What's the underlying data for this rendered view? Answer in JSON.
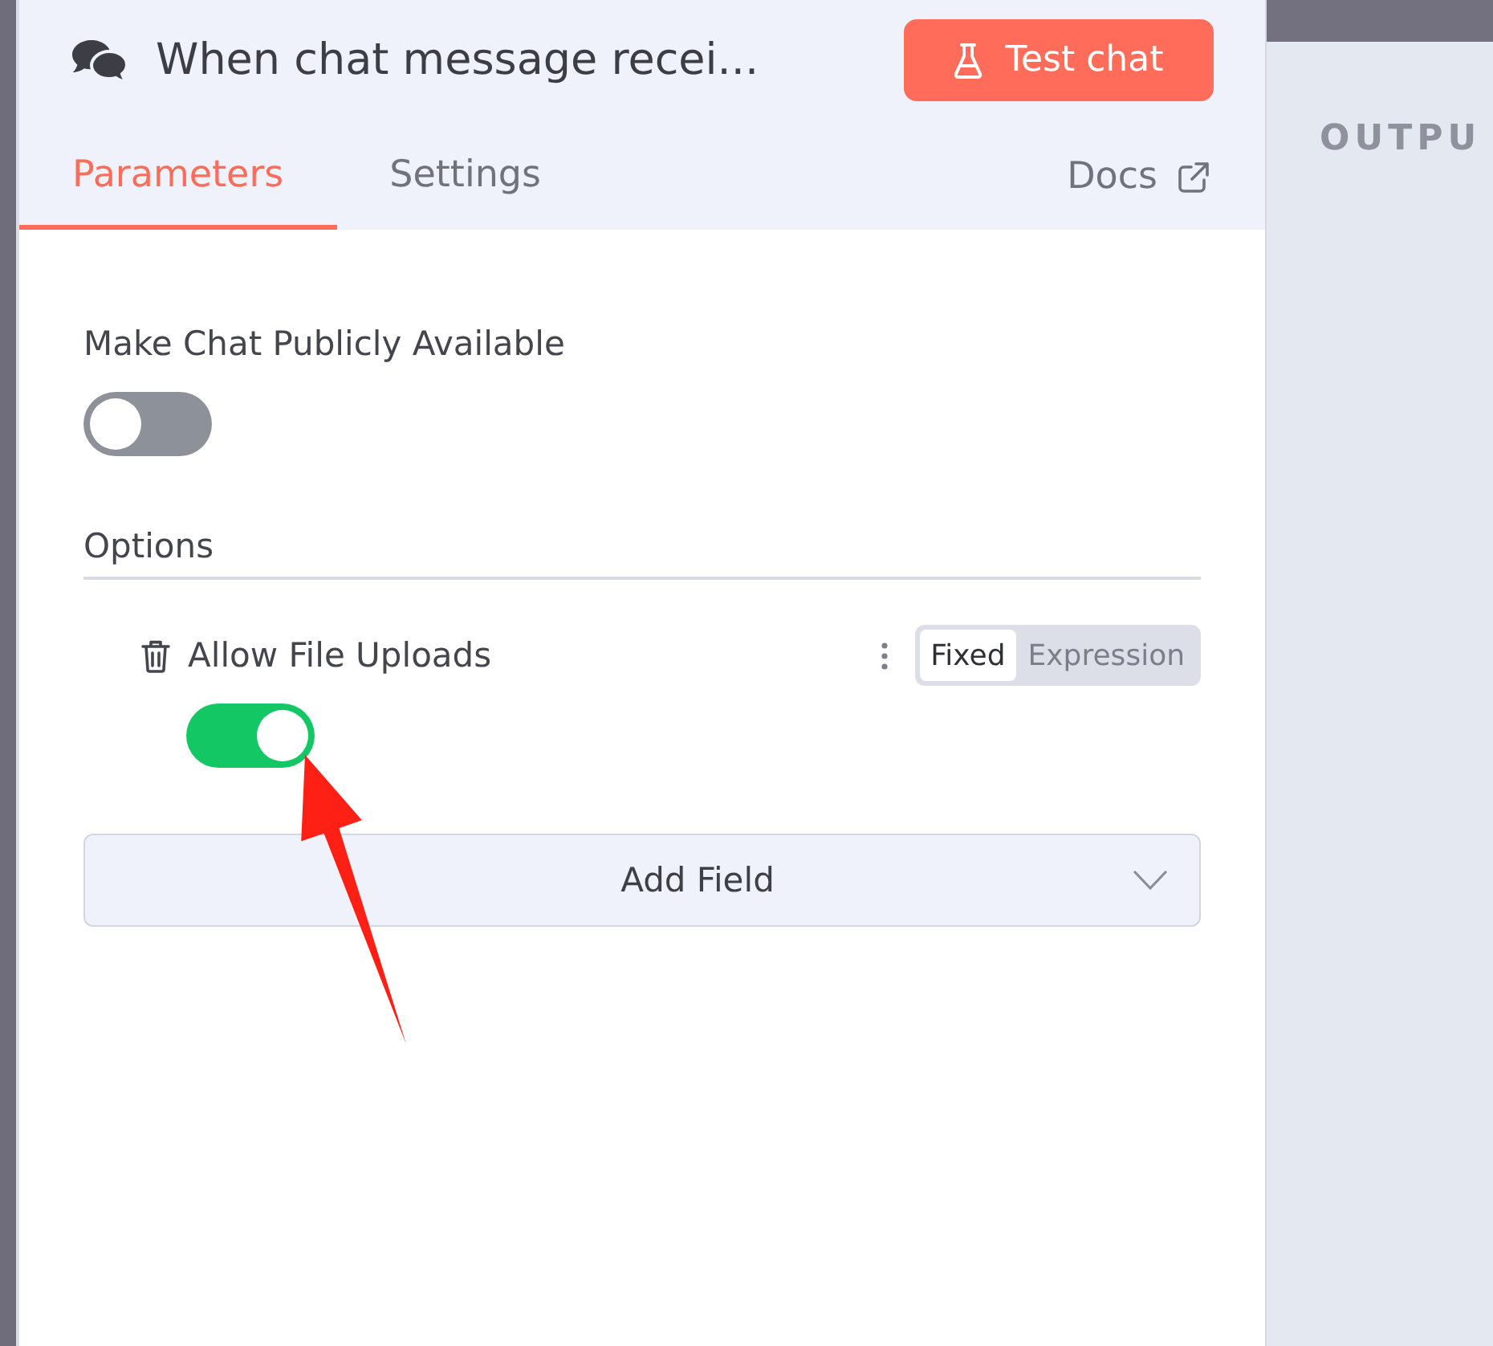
{
  "header": {
    "title": "When chat message recei...",
    "test_button": "Test chat"
  },
  "tabs": [
    {
      "label": "Parameters",
      "selected": true
    },
    {
      "label": "Settings",
      "selected": false
    }
  ],
  "docs_link": "Docs",
  "parameters": [
    {
      "kind": "toggle",
      "label": "Make Chat Publicly Available",
      "on": false
    }
  ],
  "options": {
    "title": "Options",
    "items": [
      {
        "kind": "toggle",
        "label": "Allow File Uploads",
        "on": true,
        "modes": [
          {
            "label": "Fixed",
            "selected": true
          },
          {
            "label": "Expression",
            "selected": false
          }
        ]
      }
    ],
    "add_button": "Add Field"
  },
  "output_panel": {
    "title": "OUTPU"
  }
}
